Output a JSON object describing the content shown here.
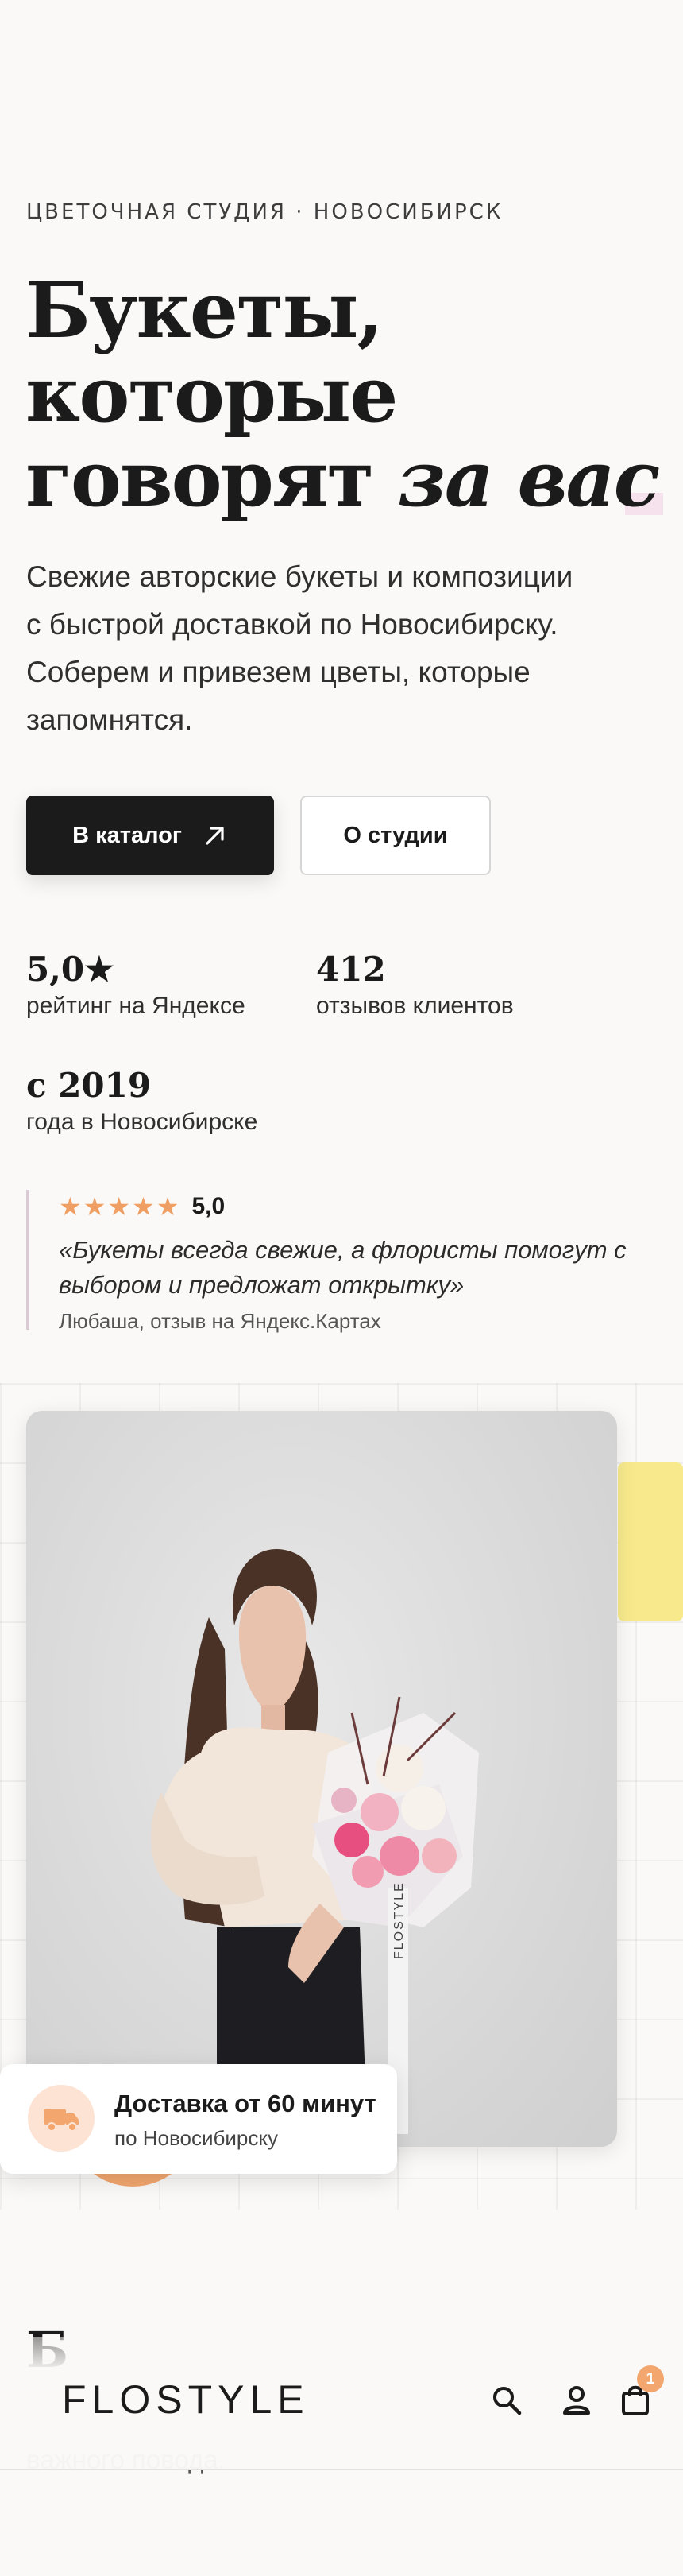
{
  "hero": {
    "eyebrow": "ЦВЕТОЧНАЯ СТУДИЯ · НОВОСИБИРСК",
    "title_line1": "Букеты,",
    "title_line2": "которые",
    "title_line3_plain": "говорят ",
    "title_line3_em": "за вас",
    "description": "Свежие авторские букеты и композиции с быстрой доставкой по Новосибирску. Соберем и привезем цветы, которые запомнятся.",
    "catalog_button": "В каталог",
    "about_button": "О студии"
  },
  "stats": [
    {
      "value": "5,0★",
      "label": "рейтинг на Яндексе"
    },
    {
      "value": "412",
      "label": "отзывов клиентов"
    },
    {
      "value": "с 2019",
      "label": "года в Новосибирске"
    }
  ],
  "review": {
    "stars": 5,
    "rating": "5,0",
    "quote": "«Букеты всегда свежие, а флористы помогут с выбором и предложат открытку»",
    "author": "Любаша, отзыв на Яндекс.Картах"
  },
  "photo": {
    "ribbon_text": "FLOSTYLE"
  },
  "delivery": {
    "title": "Доставка от 60 минут",
    "subtitle": "по Новосибирску"
  },
  "next_section": {
    "title_peek": "Б",
    "text_peek": "важного повода."
  },
  "nav": {
    "logo": "FLOSTYLE",
    "cart_count": "1"
  },
  "colors": {
    "background": "#faf9f7",
    "primary": "#1b1b1b",
    "accent_peach": "#f3a66e",
    "accent_yellow": "#f8ea8c",
    "star": "#ef9f63"
  }
}
